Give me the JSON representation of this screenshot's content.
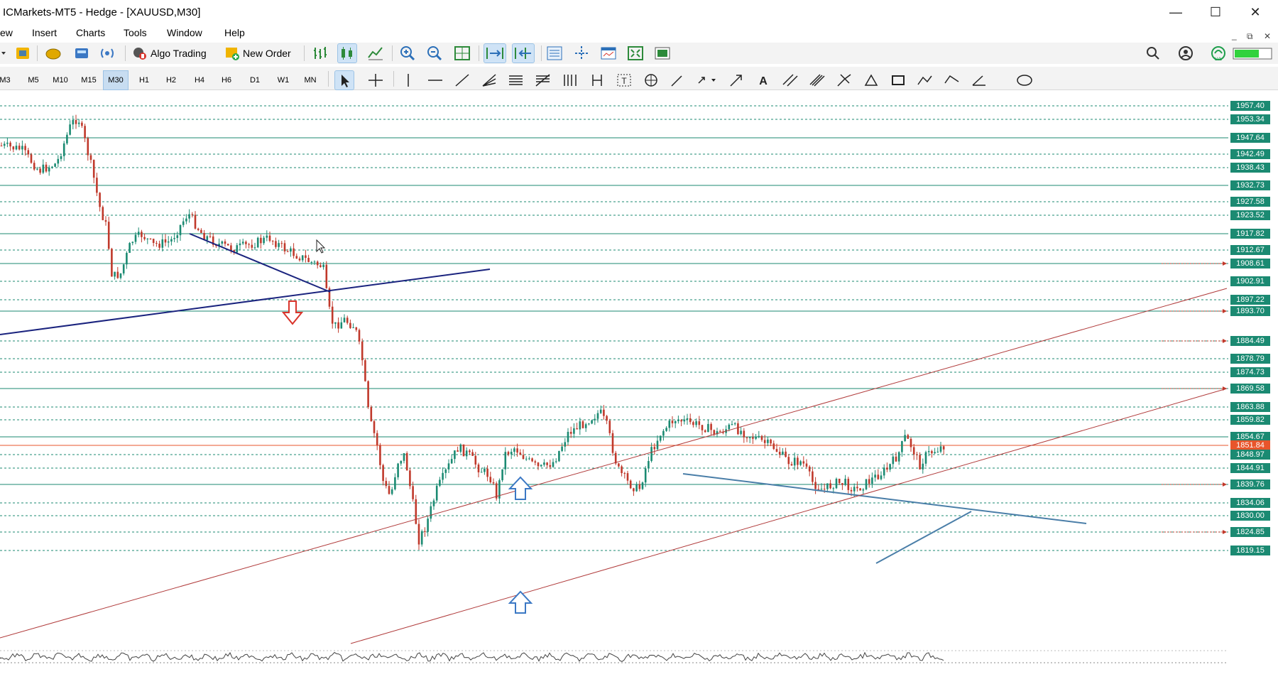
{
  "window": {
    "title": "ICMarkets-MT5 - Hedge - [XAUUSD,M30]",
    "minimize": "—",
    "maximize": "☐",
    "close": "✕"
  },
  "menu": [
    "ew",
    "Insert",
    "Charts",
    "Tools",
    "Window",
    "Help"
  ],
  "mdi_controls": [
    "_",
    "⧉",
    "✕"
  ],
  "toolbar": {
    "algo_trading": "Algo Trading",
    "new_order": "New Order"
  },
  "timeframes": [
    "M3",
    "M5",
    "M10",
    "M15",
    "M30",
    "H1",
    "H2",
    "H4",
    "H6",
    "D1",
    "W1",
    "MN"
  ],
  "active_timeframe": "M30",
  "price_levels": [
    {
      "price": "1957.40",
      "color": "#1b8a72"
    },
    {
      "price": "1953.34",
      "color": "#1b8a72"
    },
    {
      "price": "1947.64",
      "color": "#1b8a72"
    },
    {
      "price": "1942.49",
      "color": "#1b8a72"
    },
    {
      "price": "1938.43",
      "color": "#1b8a72"
    },
    {
      "price": "1932.73",
      "color": "#1b8a72"
    },
    {
      "price": "1927.58",
      "color": "#1b8a72"
    },
    {
      "price": "1923.52",
      "color": "#1b8a72"
    },
    {
      "price": "1917.82",
      "color": "#1b8a72"
    },
    {
      "price": "1912.67",
      "color": "#1b8a72"
    },
    {
      "price": "1908.61",
      "color": "#1b8a72"
    },
    {
      "price": "1902.91",
      "color": "#1b8a72"
    },
    {
      "price": "1897.22",
      "color": "#1b8a72"
    },
    {
      "price": "1893.70",
      "color": "#1b8a72"
    },
    {
      "price": "1884.49",
      "color": "#1b8a72"
    },
    {
      "price": "1878.79",
      "color": "#1b8a72"
    },
    {
      "price": "1874.73",
      "color": "#1b8a72"
    },
    {
      "price": "1869.58",
      "color": "#1b8a72"
    },
    {
      "price": "1863.88",
      "color": "#1b8a72"
    },
    {
      "price": "1859.82",
      "color": "#1b8a72"
    },
    {
      "price": "1854.67",
      "color": "#1b8a72"
    },
    {
      "price": "1851.84",
      "color": "#e8552b"
    },
    {
      "price": "1848.97",
      "color": "#1b8a72"
    },
    {
      "price": "1844.91",
      "color": "#1b8a72"
    },
    {
      "price": "1839.76",
      "color": "#1b8a72"
    },
    {
      "price": "1834.06",
      "color": "#1b8a72"
    },
    {
      "price": "1830.00",
      "color": "#1b8a72"
    },
    {
      "price": "1824.85",
      "color": "#1b8a72"
    },
    {
      "price": "1819.15",
      "color": "#1b8a72"
    }
  ],
  "colors": {
    "bull": "#1b8a72",
    "bear": "#c0392b",
    "trendline_dark": "#1a237e",
    "trendline_blue": "#4a7ea8",
    "channel": "#b03a3a",
    "current_price": "#e8552b"
  }
}
